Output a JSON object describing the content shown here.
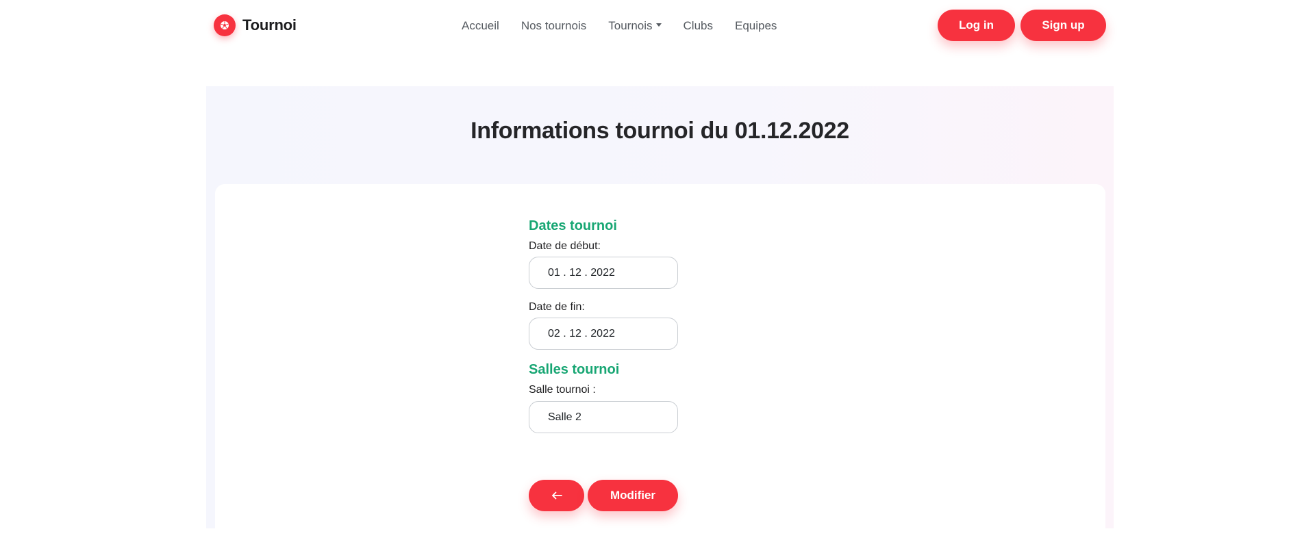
{
  "header": {
    "brand_name": "Tournoi",
    "nav": [
      {
        "label": "Accueil"
      },
      {
        "label": "Nos tournois"
      },
      {
        "label": "Tournois"
      },
      {
        "label": "Clubs"
      },
      {
        "label": "Equipes"
      }
    ],
    "login_label": "Log in",
    "signup_label": "Sign up"
  },
  "main": {
    "title": "Informations tournoi du 01.12.2022",
    "dates_heading": "Dates tournoi",
    "start_label": "Date de début:",
    "start_value": "01 . 12 . 2022",
    "end_label": "Date de fin:",
    "end_value": "02 . 12 . 2022",
    "salles_heading": "Salles tournoi",
    "salle_label": "Salle tournoi :",
    "salle_value": "Salle 2",
    "modify_label": "Modifier"
  },
  "icons": {
    "brand": "soccer-ball-icon",
    "dropdown": "caret-down-icon",
    "back": "arrow-left-icon"
  },
  "colors": {
    "accent": "#f7323f",
    "heading_green": "#17a673"
  }
}
